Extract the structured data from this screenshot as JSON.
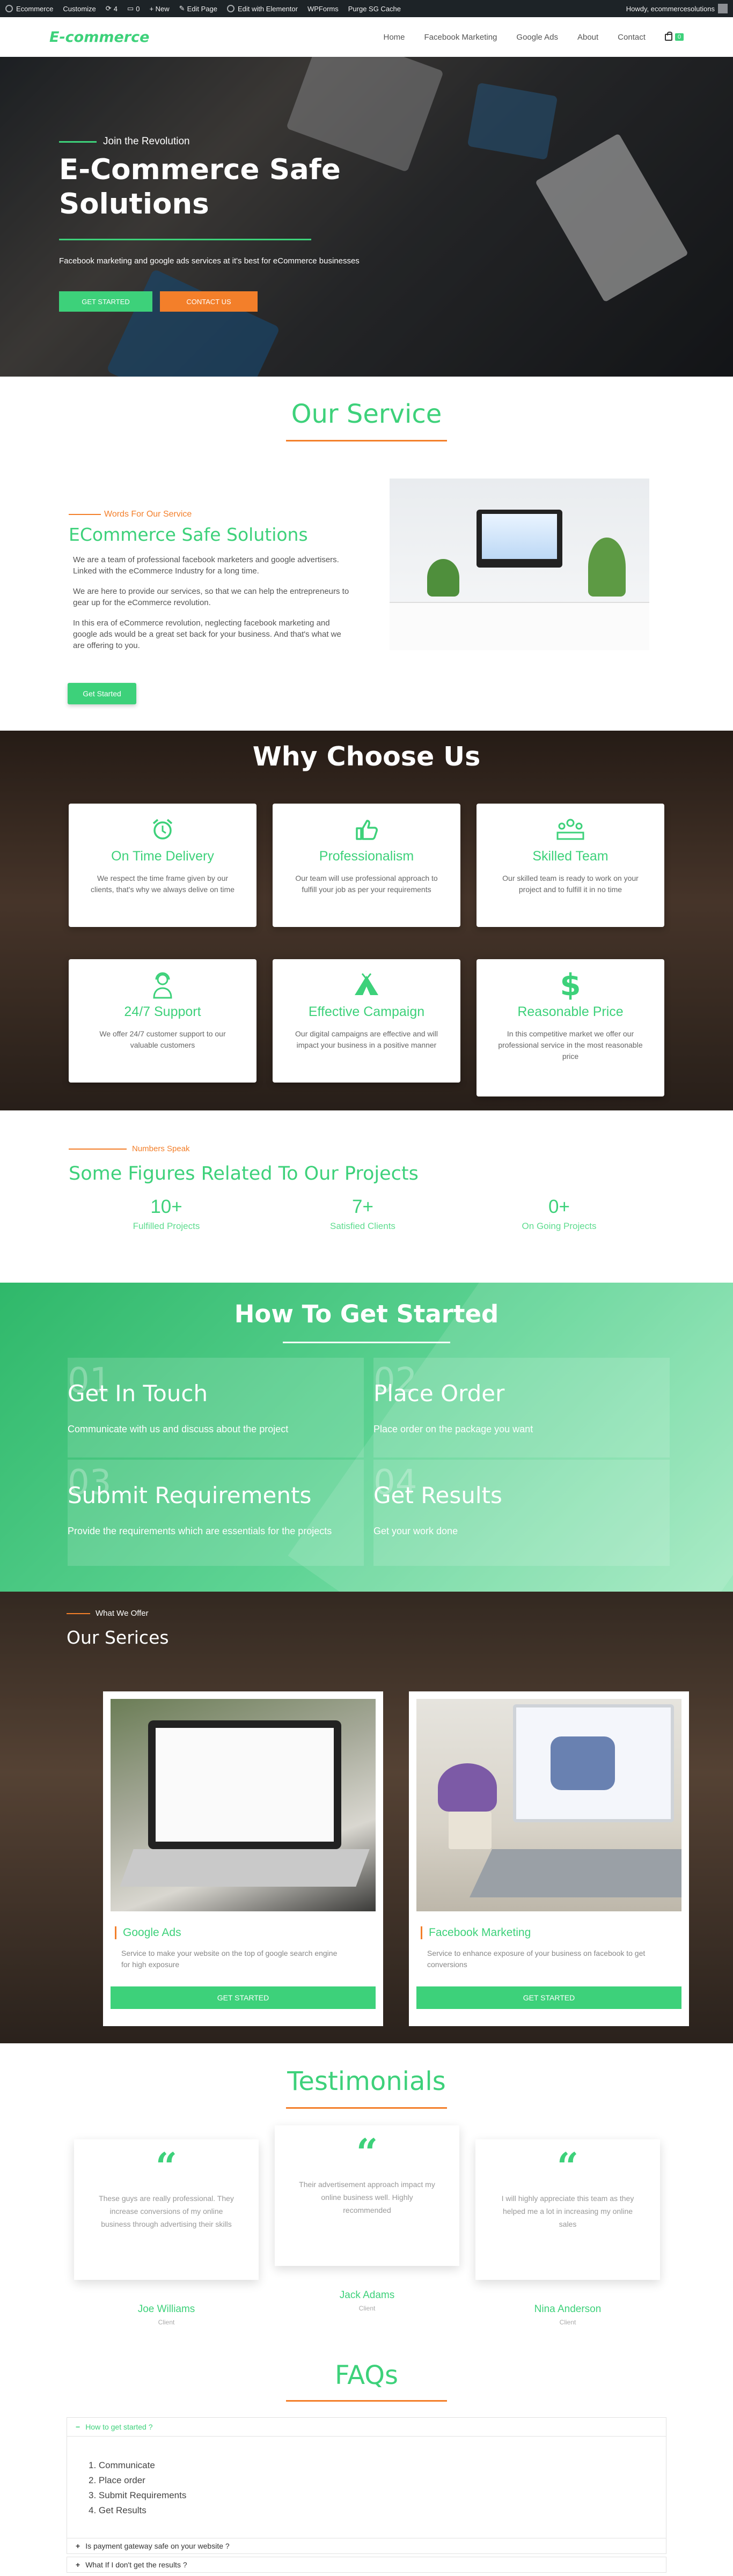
{
  "admin_bar": {
    "items": [
      "Ecommerce",
      "Customize",
      "4",
      "0",
      "+ New",
      "Edit Page",
      "Edit with Elementor",
      "WPForms",
      "Purge SG Cache"
    ],
    "greeting": "Howdy, ecommercesolutions"
  },
  "header": {
    "logo": "E-commerce",
    "nav": [
      "Home",
      "Facebook Marketing",
      "Google Ads",
      "About",
      "Contact"
    ],
    "cart_count": "0"
  },
  "hero": {
    "eyebrow": "Join the Revolution",
    "title_line1": "E-Commerce Safe",
    "title_line2": "Solutions",
    "subtitle": "Facebook marketing and google ads services at it's best for eCommerce businesses",
    "btn_primary": "Get Started",
    "btn_secondary": "Contact Us"
  },
  "service": {
    "heading": "Our Service",
    "eyebrow": "Words For Our Service",
    "title": "ECommerce Safe Solutions",
    "paragraphs": [
      "We are a team of professional facebook marketers and google advertisers. Linked with the eCommerce Industry for a long time.",
      "We are here to provide our services, so that we can help the entrepreneurs to gear up for the eCommerce revolution.",
      "In this era of eCommerce revolution, neglecting facebook marketing and google ads would be a great set back for your business.  And that's what we are offering to you."
    ],
    "button": "Get Started"
  },
  "why": {
    "heading": "Why Choose Us",
    "cards": [
      {
        "icon": "alarm-clock-icon",
        "title": "On Time Delivery",
        "text": "We respect the time frame given by our clients, that's why we always delive on time"
      },
      {
        "icon": "thumbs-up-icon",
        "title": "Professionalism",
        "text": "Our team will use professional approach to fulfill your job as per your requirements"
      },
      {
        "icon": "team-icon",
        "title": "Skilled Team",
        "text": "Our skilled team is ready to work on your project and to fulfill it in no time"
      },
      {
        "icon": "support-agent-icon",
        "title": "24/7 Support",
        "text": "We offer 24/7 customer support to our valuable customers"
      },
      {
        "icon": "campground-icon",
        "title": "Effective Campaign",
        "text": "Our digital campaigns are effective and will impact your business in a positive manner"
      },
      {
        "icon": "dollar-sign-icon",
        "title": "Reasonable Price",
        "text": "In this competitive market we offer our professional service in the most reasonable price"
      }
    ]
  },
  "figures": {
    "eyebrow": "Numbers Speak",
    "title": "Some Figures Related To Our Projects",
    "stats": [
      {
        "value": "10+",
        "label": "Fulfilled Projects"
      },
      {
        "value": "7+",
        "label": "Satisfied Clients"
      },
      {
        "value": "0+",
        "label": "On Going Projects"
      }
    ]
  },
  "how": {
    "heading": "How To Get Started",
    "steps": [
      {
        "num": "01",
        "title": "Get In Touch",
        "text": "Communicate with us and discuss about the project"
      },
      {
        "num": "02",
        "title": "Place Order",
        "text": "Place order on the package you want"
      },
      {
        "num": "03",
        "title": "Submit Requirements",
        "text": "Provide the requirements which are essentials for the projects"
      },
      {
        "num": "04",
        "title": "Get Results",
        "text": "Get your work done"
      }
    ]
  },
  "offer": {
    "eyebrow": "What We Offer",
    "title": "Our Serices",
    "cards": [
      {
        "title": "Google Ads",
        "text": "Service to make your website on the top of google search engine for high exposure",
        "button": "Get Started"
      },
      {
        "title": "Facebook Marketing",
        "text": "Service to enhance exposure of your business on facebook to get conversions",
        "button": "Get Started"
      }
    ]
  },
  "testimonials": {
    "heading": "Testimonials",
    "items": [
      {
        "quote": "These guys are really professional. They increase conversions of my online business through advertising their skills",
        "name": "Joe Williams",
        "role": "Client"
      },
      {
        "quote": "Their advertisement approach impact my online business well. Highly recommended",
        "name": "Jack Adams",
        "role": "Client"
      },
      {
        "quote": "I will highly appreciate this team as they helped me a lot in increasing my online sales",
        "name": "Nina Anderson",
        "role": "Client"
      }
    ]
  },
  "faqs": {
    "heading": "FAQs",
    "items": [
      {
        "question": "How to get started ?",
        "answer": [
          "1. Communicate",
          "2. Place order",
          "3. Submit Requirements",
          "4. Get Results"
        ]
      },
      {
        "question": "Is payment gateway safe on your website ?"
      },
      {
        "question": "What If I don't get the results ?"
      }
    ]
  },
  "colors": {
    "brand_green": "#3dd17a",
    "accent_orange": "#f37f2a"
  }
}
